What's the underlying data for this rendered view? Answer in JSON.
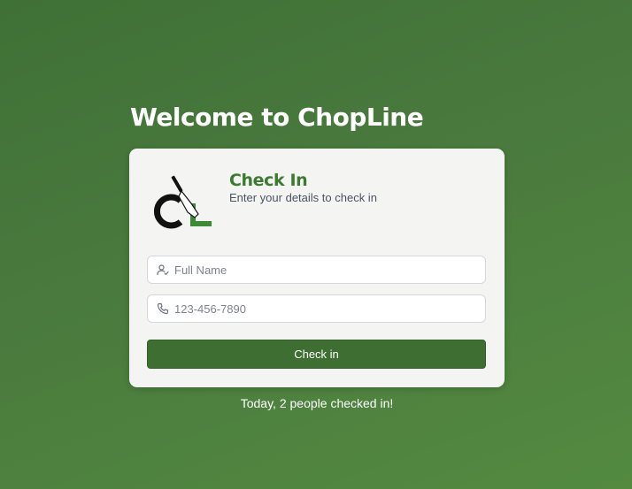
{
  "page": {
    "title": "Welcome to ChopLine"
  },
  "card": {
    "heading": "Check In",
    "subtitle": "Enter your details to check in",
    "logo": {
      "letters": "CL",
      "icon": "cleaver-knife-icon",
      "colors": {
        "c": "#111111",
        "l": "#3d8a35"
      }
    }
  },
  "form": {
    "name_field": {
      "placeholder": "Full Name",
      "value": "",
      "icon": "user-check-icon"
    },
    "phone_field": {
      "placeholder": "123-456-7890",
      "value": "",
      "icon": "phone-icon"
    },
    "submit_label": "Check in"
  },
  "status": {
    "message": "Today, 2 people checked in!"
  },
  "colors": {
    "background": "#4a7a3e",
    "accent": "#3d7a30",
    "button": "#3f6e33"
  }
}
